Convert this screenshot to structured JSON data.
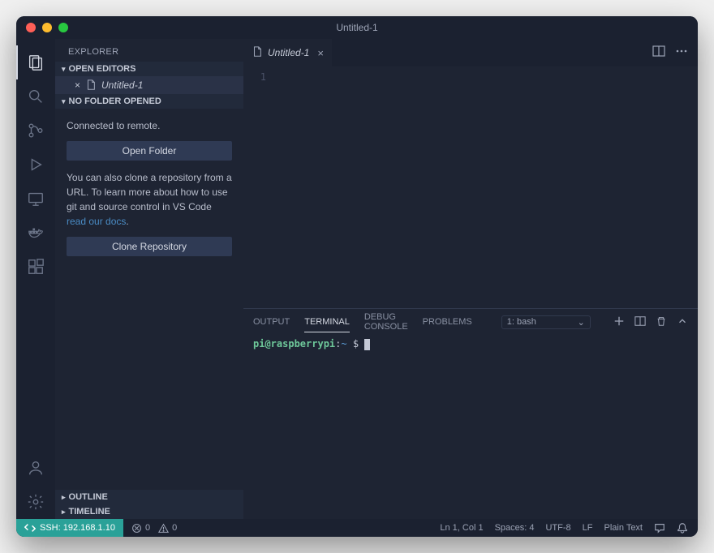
{
  "window": {
    "title": "Untitled-1"
  },
  "explorer": {
    "title": "EXPLORER",
    "openEditors": {
      "label": "OPEN EDITORS",
      "file": "Untitled-1"
    },
    "noFolder": {
      "label": "NO FOLDER OPENED",
      "connected": "Connected to remote.",
      "openFolder": "Open Folder",
      "cloneText1": "You can also clone a repository from a URL. To learn more about how to use git and source control in VS Code ",
      "cloneLink": "read our docs",
      "cloneText2": ".",
      "cloneRepo": "Clone Repository"
    },
    "outline": "OUTLINE",
    "timeline": "TIMELINE"
  },
  "tab": {
    "name": "Untitled-1"
  },
  "editor": {
    "lineNumber": "1"
  },
  "panel": {
    "tabs": {
      "output": "OUTPUT",
      "terminal": "TERMINAL",
      "debug": "DEBUG CONSOLE",
      "problems": "PROBLEMS"
    },
    "termSelect": "1: bash",
    "prompt": {
      "user": "pi@raspberrypi",
      "path": "~",
      "dollar": "$"
    }
  },
  "status": {
    "ssh": "SSH: 192.168.1.10",
    "errors": "0",
    "warnings": "0",
    "lncol": "Ln 1, Col 1",
    "spaces": "Spaces: 4",
    "encoding": "UTF-8",
    "eol": "LF",
    "lang": "Plain Text"
  }
}
